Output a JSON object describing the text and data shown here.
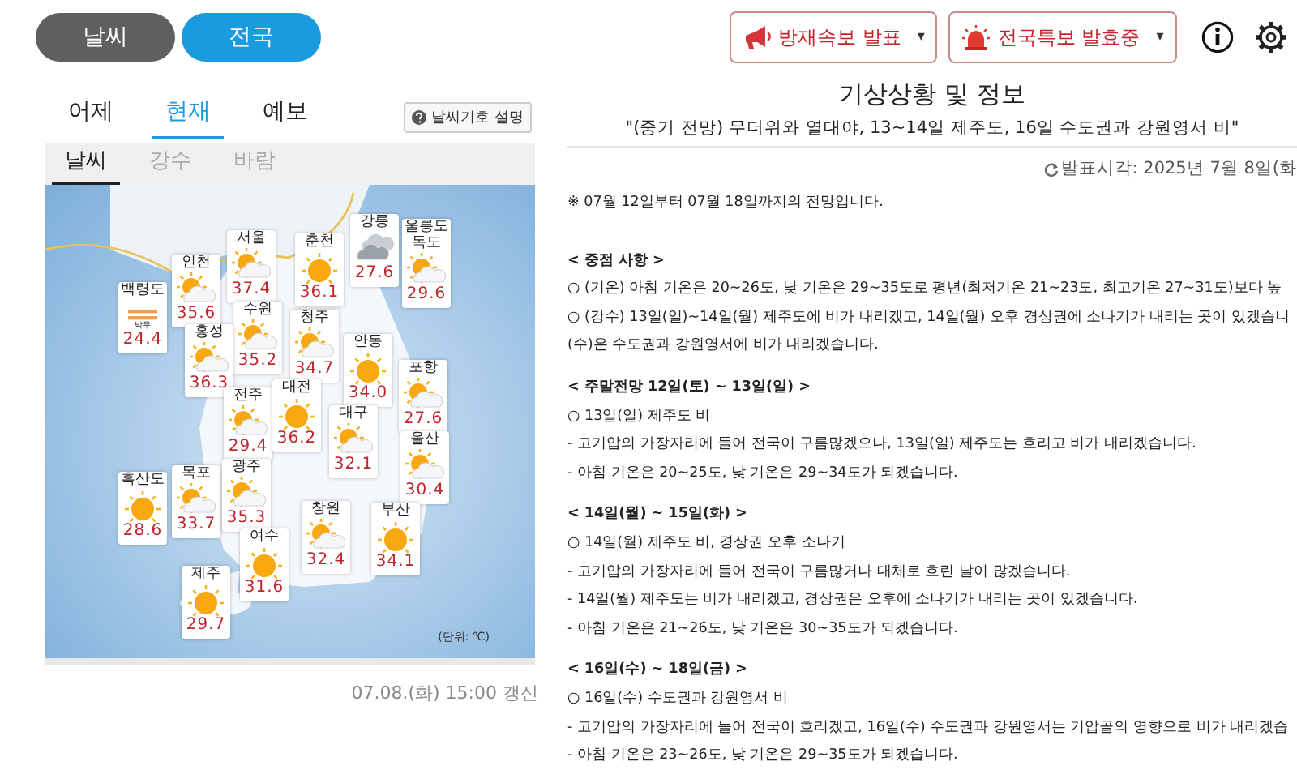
{
  "top_toggle": [
    {
      "label": "날씨",
      "selected": false
    },
    {
      "label": "전국",
      "selected": true
    }
  ],
  "alert_buttons": [
    {
      "kind": "megaphone",
      "label": "방재속보 발표",
      "caret": "▾"
    },
    {
      "kind": "siren",
      "label": "전국특보 발효중",
      "caret": "▾"
    }
  ],
  "period_tabs": [
    {
      "label": "어제",
      "selected": false
    },
    {
      "label": "현재",
      "selected": true
    },
    {
      "label": "예보",
      "selected": false
    }
  ],
  "legend_button": {
    "label": "날씨기호 설명"
  },
  "map_tabs": [
    {
      "label": "날씨",
      "selected": true
    },
    {
      "label": "강수",
      "selected": false
    },
    {
      "label": "바람",
      "selected": false
    }
  ],
  "stations": [
    {
      "name": "서울",
      "kind": "partly_cloudy",
      "temp": "37.4"
    },
    {
      "name": "인천",
      "kind": "partly_cloudy",
      "temp": "35.6"
    },
    {
      "name": "백령도",
      "kind": "haze",
      "note": "박무",
      "temp": "24.4"
    },
    {
      "name": "춘천",
      "kind": "sunny",
      "temp": "36.1"
    },
    {
      "name": "강릉",
      "kind": "cloudy",
      "temp": "27.6"
    },
    {
      "name": "울릉도\n독도",
      "kind": "partly_cloudy",
      "temp": "29.6"
    },
    {
      "name": "수원",
      "kind": "partly_cloudy",
      "temp": "35.2"
    },
    {
      "name": "홍성",
      "kind": "partly_cloudy",
      "temp": "36.3"
    },
    {
      "name": "청주",
      "kind": "partly_cloudy",
      "temp": "34.7"
    },
    {
      "name": "안동",
      "kind": "sunny",
      "temp": "34.0"
    },
    {
      "name": "포항",
      "kind": "partly_cloudy",
      "temp": "27.6"
    },
    {
      "name": "전주",
      "kind": "partly_cloudy",
      "temp": "29.4"
    },
    {
      "name": "대전",
      "kind": "sunny",
      "temp": "36.2"
    },
    {
      "name": "대구",
      "kind": "partly_cloudy",
      "temp": "32.1"
    },
    {
      "name": "울산",
      "kind": "partly_cloudy",
      "temp": "30.4"
    },
    {
      "name": "흑산도",
      "kind": "sunny",
      "temp": "28.6"
    },
    {
      "name": "목포",
      "kind": "partly_cloudy",
      "temp": "33.7"
    },
    {
      "name": "광주",
      "kind": "partly_cloudy",
      "temp": "35.3"
    },
    {
      "name": "여수",
      "kind": "sunny",
      "temp": "31.6"
    },
    {
      "name": "창원",
      "kind": "partly_cloudy",
      "temp": "32.4"
    },
    {
      "name": "부산",
      "kind": "sunny",
      "temp": "34.1"
    },
    {
      "name": "제주",
      "kind": "sunny",
      "temp": "29.7"
    }
  ],
  "map_unit": "(단위: ℃)",
  "updated": "07.08.(화) 15:00 갱신",
  "info": {
    "title": "기상상황 및 정보",
    "subtitle": "\"(중기 전망) 무더위와 열대야, 13~14일 제주도, 16일 수도권과 강원영서 비\"",
    "issued": "발표시각: 2025년 7월 8일(화",
    "note": "※ 07월 12일부터 07월 18일까지의 전망입니다.",
    "sections": [
      {
        "heading": "< 중점 사항 >",
        "lines": [
          "○ (기온) 아침 기온은 20~26도, 낮 기온은 29~35도로 평년(최저기온 21~23도, 최고기온 27~31도)보다 높",
          "○ (강수) 13일(일)~14일(월) 제주도에 비가 내리겠고, 14일(월) 오후 경상권에 소나기가 내리는 곳이 있겠습니",
          "(수)은 수도권과 강원영서에 비가 내리겠습니다."
        ]
      },
      {
        "heading": "< 주말전망 12일(토) ~ 13일(일) >",
        "lines": [
          "○ 13일(일) 제주도 비",
          "- 고기압의 가장자리에 들어 전국이 구름많겠으나, 13일(일) 제주도는 흐리고 비가 내리겠습니다.",
          "- 아침 기온은 20~25도, 낮 기온은 29~34도가 되겠습니다."
        ]
      },
      {
        "heading": "< 14일(월) ~ 15일(화) >",
        "lines": [
          "○ 14일(월) 제주도 비, 경상권 오후 소나기",
          "- 고기압의 가장자리에 들어 전국이 구름많거나 대체로 흐린 날이 많겠습니다.",
          "- 14일(월) 제주도는 비가 내리겠고, 경상권은 오후에 소나기가 내리는 곳이 있겠습니다.",
          "- 아침 기온은 21~26도, 낮 기온은 30~35도가 되겠습니다."
        ]
      },
      {
        "heading": "< 16일(수) ~ 18일(금) >",
        "lines": [
          "○ 16일(수) 수도권과 강원영서 비",
          "- 고기압의 가장자리에 들어 전국이 흐리겠고, 16일(수) 수도권과 강원영서는 기압골의 영향으로 비가 내리겠습",
          "- 아침 기온은 23~26도, 낮 기온은 29~35도가 되겠습니다."
        ]
      }
    ]
  }
}
